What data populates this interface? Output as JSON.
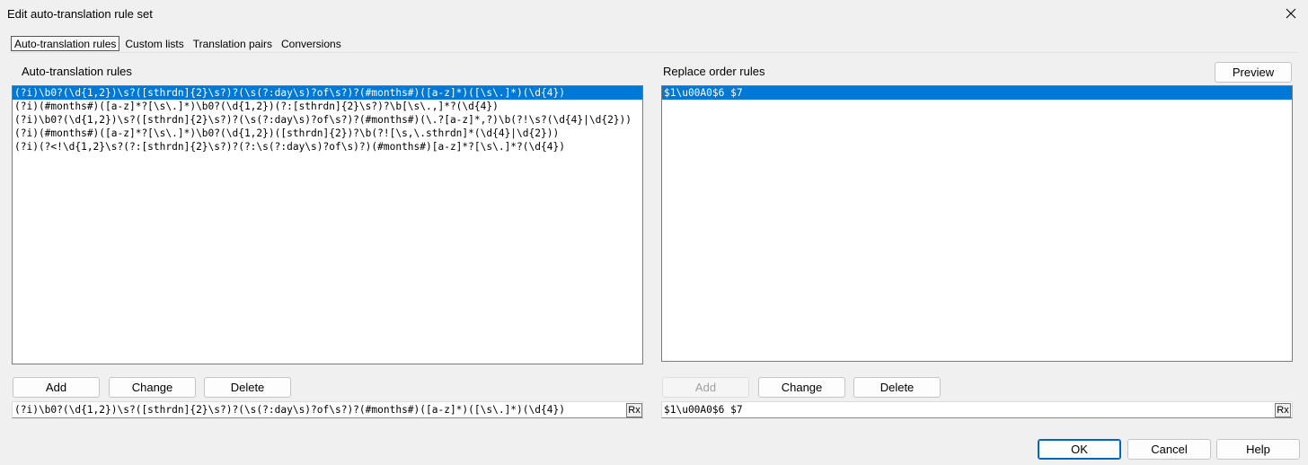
{
  "window": {
    "title": "Edit auto-translation rule set"
  },
  "tabs": [
    {
      "label": "Auto-translation rules"
    },
    {
      "label": "Custom lists"
    },
    {
      "label": "Translation pairs"
    },
    {
      "label": "Conversions"
    }
  ],
  "left": {
    "label": "Auto-translation rules",
    "rules": [
      "(?i)\\b0?(\\d{1,2})\\s?([sthrdn]{2}\\s?)?(\\s(?:day\\s)?of\\s?)?(#months#)([a-z]*)([\\s\\.]*)(\\d{4})",
      "(?i)(#months#)([a-z]*?[\\s\\.]*)\\b0?(\\d{1,2})(?:[sthrdn]{2}\\s?)?\\b[\\s\\.,]*?(\\d{4})",
      "(?i)\\b0?(\\d{1,2})\\s?([sthrdn]{2}\\s?)?(\\s(?:day\\s)?of\\s?)?(#months#)(\\.?[a-z]*,?)\\b(?!\\s?(\\d{4}|\\d{2}))",
      "(?i)(#months#)([a-z]*?[\\s\\.]*)\\b0?(\\d{1,2})([sthrdn]{2})?\\b(?![\\s,\\.sthrdn]*(\\d{4}|\\d{2}))",
      "(?i)(?<!\\d{1,2}\\s?(?:[sthrdn]{2}\\s?)?(?:\\s(?:day\\s)?of\\s)?)(#months#)[a-z]*?[\\s\\.]*?(\\d{4})"
    ],
    "buttons": {
      "add": "Add",
      "change": "Change",
      "delete": "Delete"
    },
    "edit_value": "(?i)\\b0?(\\d{1,2})\\s?([sthrdn]{2}\\s?)?(\\s(?:day\\s)?of\\s?)?(#months#)([a-z]*)([\\s\\.]*)(\\d{4})",
    "rx_label": "Rx"
  },
  "right": {
    "label": "Replace order rules",
    "preview_label": "Preview",
    "rules": [
      "$1\\u00A0$6 $7"
    ],
    "buttons": {
      "add": "Add",
      "change": "Change",
      "delete": "Delete"
    },
    "edit_value": "$1\\u00A0$6 $7",
    "rx_label": "Rx"
  },
  "footer": {
    "ok": "OK",
    "cancel": "Cancel",
    "help": "Help"
  },
  "colors": {
    "selection": "#0078d7",
    "primary_border": "#0067c0"
  }
}
